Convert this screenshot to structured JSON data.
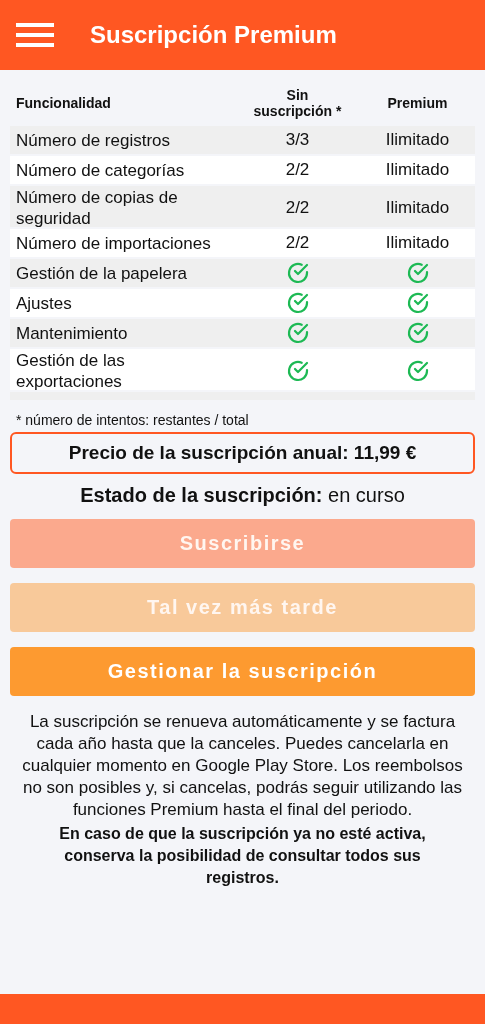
{
  "app_bar": {
    "title": "Suscripción Premium"
  },
  "table": {
    "columns": [
      "Funcionalidad",
      "Sin suscripción *",
      "Premium"
    ],
    "rows": [
      {
        "feature": "Número de registros",
        "free": {
          "kind": "text",
          "text": "3/3"
        },
        "premium": {
          "kind": "text",
          "text": "Ilimitado"
        }
      },
      {
        "feature": "Número de categorías",
        "free": {
          "kind": "text",
          "text": "2/2"
        },
        "premium": {
          "kind": "text",
          "text": "Ilimitado"
        }
      },
      {
        "feature": "Número de copias de seguridad",
        "free": {
          "kind": "text",
          "text": "2/2"
        },
        "premium": {
          "kind": "text",
          "text": "Ilimitado"
        }
      },
      {
        "feature": "Número de importaciones",
        "free": {
          "kind": "text",
          "text": "2/2"
        },
        "premium": {
          "kind": "text",
          "text": "Ilimitado"
        }
      },
      {
        "feature": "Gestión de la papelera",
        "free": {
          "kind": "check"
        },
        "premium": {
          "kind": "check"
        }
      },
      {
        "feature": "Ajustes",
        "free": {
          "kind": "check"
        },
        "premium": {
          "kind": "check"
        }
      },
      {
        "feature": "Mantenimiento",
        "free": {
          "kind": "check"
        },
        "premium": {
          "kind": "check"
        }
      },
      {
        "feature": "Gestión de las exportaciones",
        "free": {
          "kind": "check"
        },
        "premium": {
          "kind": "check"
        }
      }
    ]
  },
  "footnote": "* número de intentos: restantes / total",
  "price": "Precio de la suscripción anual: 11,99 €",
  "status": {
    "label": "Estado de la suscripción:",
    "value": "en curso"
  },
  "buttons": [
    {
      "label": "Suscribirse",
      "color": "#fba98d",
      "disabled": true
    },
    {
      "label": "Tal vez más tarde",
      "color": "#f8c99a",
      "disabled": true
    },
    {
      "label": "Gestionar la suscripción",
      "color": "#fd9a30",
      "disabled": false
    }
  ],
  "info": "La suscripción se renueva automáticamente y se factura cada año hasta que la canceles. Puedes cancelarla en cualquier momento en Google Play Store. Los reembolsos no son posibles y, si cancelas, podrás seguir utilizando las funciones Premium hasta el final del periodo.",
  "notice": "En caso de que la suscripción ya no esté activa, conserva la posibilidad de consultar todos sus registros."
}
